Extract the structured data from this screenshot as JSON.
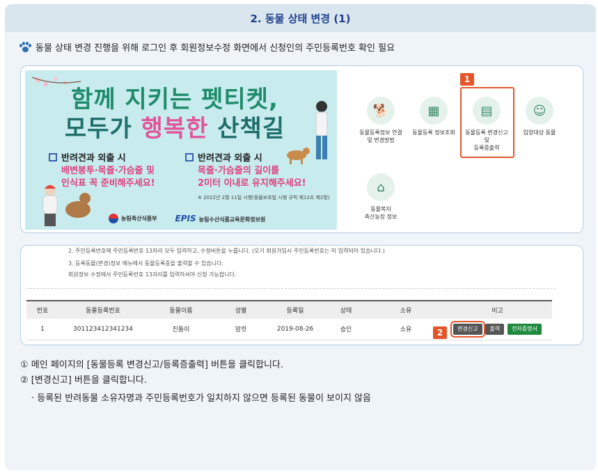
{
  "header": {
    "title": "2. 동물 상태 변경 (1)"
  },
  "intro_text": "동물 상태 변경 진행을 위해 로그인 후 회원정보수정 화면에서 신청인의 주민등록번호 확인 필요",
  "banner": {
    "headline1": "함께 지키는 펫티켓,",
    "headline2_a": "모두가 ",
    "headline2_b": "행복한",
    "headline2_c": " 산책길",
    "tip1_title": "반려견과 외출 시",
    "tip1_line1": "배변봉투·목줄·가슴줄 및",
    "tip1_line2": "인식표 꼭 준비해주세요!",
    "tip2_title": "반려견과 외출 시",
    "tip2_line1": "목줄·가슴줄의 길이를",
    "tip2_line2": "2미터 이내로 유지해주세요!",
    "tip2_note": "※ 2022년 2월 11일 시행(동물보호법 시행 규칙 제12조 제2항)",
    "logo1": "농림축산식품부",
    "logo2_mark": "EPIS",
    "logo2": "농림수산식품교육문화정보원"
  },
  "menu": {
    "items": [
      {
        "label_l1": "동물등록정보 연결",
        "label_l2": "및 변경방법",
        "label_l3": "",
        "icon": "dog-icon"
      },
      {
        "label_l1": "동물등록 정보조회",
        "label_l2": "",
        "label_l3": "",
        "icon": "tombstone-icon"
      },
      {
        "label_l1": "동물등록 변경신고",
        "label_l2": "및",
        "label_l3": "등록증출력",
        "icon": "certificate-icon"
      },
      {
        "label_l1": "입양대상 동물",
        "label_l2": "",
        "label_l3": "",
        "icon": "adopt-icon"
      },
      {
        "label_l1": "동물복지",
        "label_l2": "축산농장 정보",
        "label_l3": "",
        "icon": "farm-icon"
      }
    ],
    "badge1": "1"
  },
  "notes": {
    "line1": "2. 주민등록번호에 주민등록번호 13자리 모두 입력하고, 수정버튼을 누릅니다. (오기 회원가입시 주민등록번호는 미 입력되어 있습니다.)",
    "line2": "3. 등록동물(변경)정보 메뉴에서 동물등록증을 출력할 수 있습니다.",
    "line3": "회원정보 수정에서 주민등록번호 13자리를 입력하셔야 신청 가능합니다."
  },
  "table": {
    "headers": [
      "번호",
      "동물등록번호",
      "동물이름",
      "성별",
      "등록일",
      "상태",
      "소유",
      "비고"
    ],
    "row": {
      "no": "1",
      "reg_no": "301123412341234",
      "name": "진돌이",
      "sex": "암컷",
      "date": "2019-08-26",
      "status": "승인",
      "own": "소유"
    },
    "btn_change": "변경신고",
    "btn_print": "출력",
    "btn_cert": "전자증명서",
    "badge2": "2"
  },
  "steps": {
    "step1": "① 메인 페이지의 [동물등록 변경신고/등록증출력] 버튼을 클릭합니다.",
    "step2": "② [변경신고] 버튼을 클릭합니다.",
    "sub": "· 등록된 반려동물 소유자명과 주민등록번호가 일치하지 않으면 등록된 동물이 보이지 않음"
  },
  "colors": {
    "accent": "#e4552a",
    "title": "#1f3f8c",
    "banner_bg": "#c8ebee",
    "green_btn": "#1e8a3e"
  }
}
